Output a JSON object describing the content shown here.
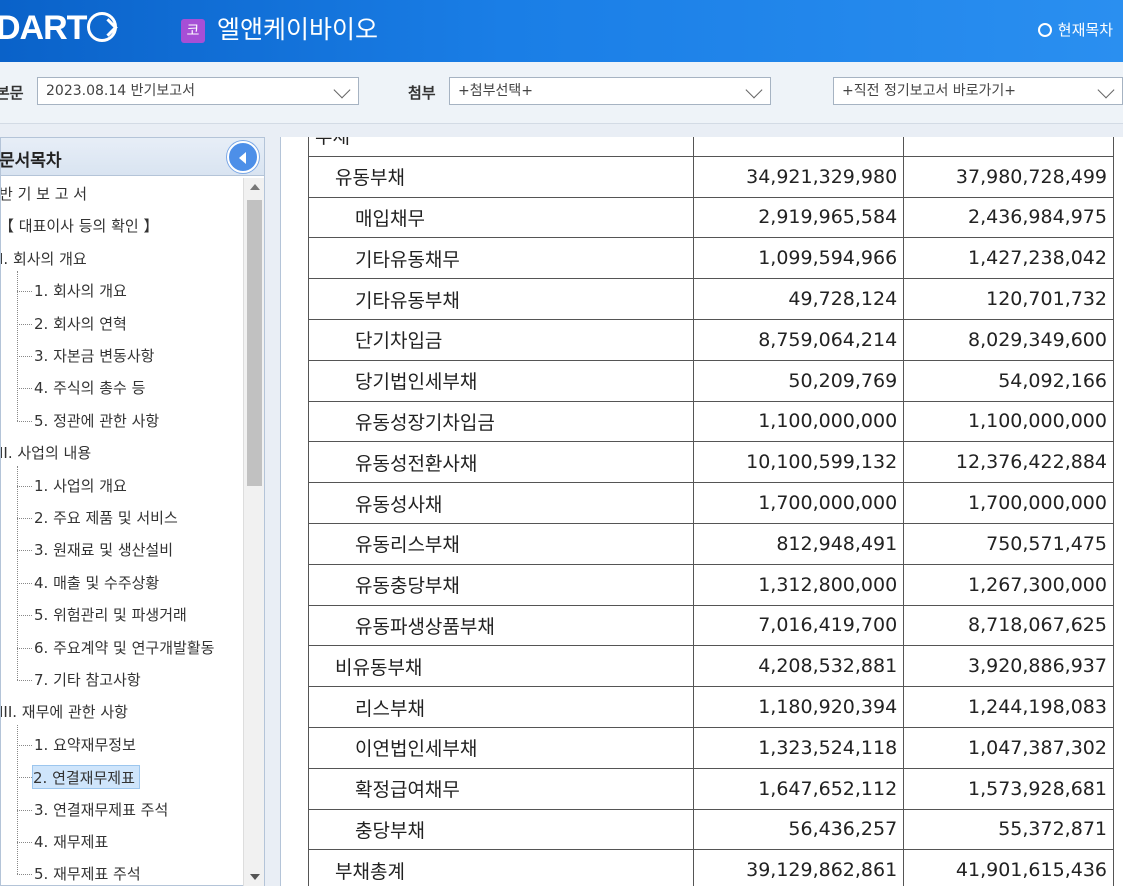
{
  "header": {
    "logo_text": "DART",
    "company_badge": "코",
    "company_name": "엘앤케이바이오",
    "current_toc": "현재목차"
  },
  "selectbar": {
    "main_label": "본문",
    "main_value": "2023.08.14   반기보고서",
    "attach_label": "첨부",
    "attach_value": "+첨부선택+",
    "prev_value": "+직전 정기보고서 바로가기+"
  },
  "toc": {
    "title": "문서목차",
    "items": [
      {
        "label": "반 기 보 고 서",
        "level": 0
      },
      {
        "label": "【 대표이사 등의 확인 】",
        "level": 0
      },
      {
        "label": "I. 회사의 개요",
        "level": 0
      },
      {
        "label": "1. 회사의 개요",
        "level": 1
      },
      {
        "label": "2. 회사의 연혁",
        "level": 1
      },
      {
        "label": "3. 자본금 변동사항",
        "level": 1
      },
      {
        "label": "4. 주식의 총수 등",
        "level": 1
      },
      {
        "label": "5. 정관에 관한 사항",
        "level": 1
      },
      {
        "label": "II. 사업의 내용",
        "level": 0
      },
      {
        "label": "1. 사업의 개요",
        "level": 1
      },
      {
        "label": "2. 주요 제품 및 서비스",
        "level": 1
      },
      {
        "label": "3. 원재료 및 생산설비",
        "level": 1
      },
      {
        "label": "4. 매출 및 수주상황",
        "level": 1
      },
      {
        "label": "5. 위험관리 및 파생거래",
        "level": 1
      },
      {
        "label": "6. 주요계약 및 연구개발활동",
        "level": 1
      },
      {
        "label": "7. 기타 참고사항",
        "level": 1
      },
      {
        "label": "III. 재무에 관한 사항",
        "level": 0
      },
      {
        "label": "1. 요약재무정보",
        "level": 1
      },
      {
        "label": "2. 연결재무제표",
        "level": 1,
        "active": true
      },
      {
        "label": "3. 연결재무제표 주석",
        "level": 1
      },
      {
        "label": "4. 재무제표",
        "level": 1
      },
      {
        "label": "5. 재무제표 주석",
        "level": 1
      }
    ]
  },
  "table": {
    "rows": [
      {
        "label": "부채",
        "level": 0,
        "v1": "",
        "v2": ""
      },
      {
        "label": "유동부채",
        "level": 1,
        "v1": "34,921,329,980",
        "v2": "37,980,728,499"
      },
      {
        "label": "매입채무",
        "level": 2,
        "v1": "2,919,965,584",
        "v2": "2,436,984,975"
      },
      {
        "label": "기타유동채무",
        "level": 2,
        "v1": "1,099,594,966",
        "v2": "1,427,238,042"
      },
      {
        "label": "기타유동부채",
        "level": 2,
        "v1": "49,728,124",
        "v2": "120,701,732"
      },
      {
        "label": "단기차입금",
        "level": 2,
        "v1": "8,759,064,214",
        "v2": "8,029,349,600"
      },
      {
        "label": "당기법인세부채",
        "level": 2,
        "v1": "50,209,769",
        "v2": "54,092,166"
      },
      {
        "label": "유동성장기차입금",
        "level": 2,
        "v1": "1,100,000,000",
        "v2": "1,100,000,000"
      },
      {
        "label": "유동성전환사채",
        "level": 2,
        "v1": "10,100,599,132",
        "v2": "12,376,422,884"
      },
      {
        "label": "유동성사채",
        "level": 2,
        "v1": "1,700,000,000",
        "v2": "1,700,000,000"
      },
      {
        "label": "유동리스부채",
        "level": 2,
        "v1": "812,948,491",
        "v2": "750,571,475"
      },
      {
        "label": "유동충당부채",
        "level": 2,
        "v1": "1,312,800,000",
        "v2": "1,267,300,000"
      },
      {
        "label": "유동파생상품부채",
        "level": 2,
        "v1": "7,016,419,700",
        "v2": "8,718,067,625"
      },
      {
        "label": "비유동부채",
        "level": 1,
        "v1": "4,208,532,881",
        "v2": "3,920,886,937"
      },
      {
        "label": "리스부채",
        "level": 2,
        "v1": "1,180,920,394",
        "v2": "1,244,198,083"
      },
      {
        "label": "이연법인세부채",
        "level": 2,
        "v1": "1,323,524,118",
        "v2": "1,047,387,302"
      },
      {
        "label": "확정급여채무",
        "level": 2,
        "v1": "1,647,652,112",
        "v2": "1,573,928,681"
      },
      {
        "label": "충당부채",
        "level": 2,
        "v1": "56,436,257",
        "v2": "55,372,871"
      },
      {
        "label": "부채총계",
        "level": 1,
        "v1": "39,129,862,861",
        "v2": "41,901,615,436"
      }
    ]
  }
}
